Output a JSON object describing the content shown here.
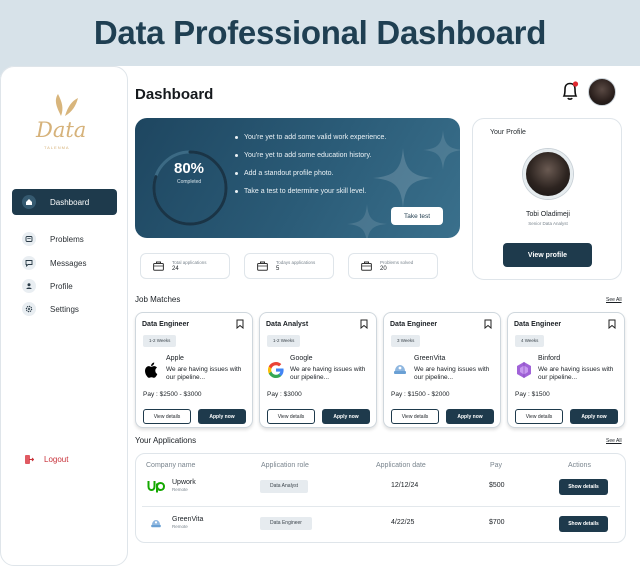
{
  "banner": {
    "title": "Data Professional Dashboard"
  },
  "brand": {
    "logo_text": "Data",
    "logo_sub": "TALENMA"
  },
  "sidebar": {
    "items": [
      {
        "label": "Dashboard",
        "icon": "home-icon",
        "active": true
      },
      {
        "label": "Problems",
        "icon": "problems-icon"
      },
      {
        "label": "Messages",
        "icon": "messages-icon"
      },
      {
        "label": "Profile",
        "icon": "user-icon"
      },
      {
        "label": "Settings",
        "icon": "gear-icon"
      }
    ],
    "logout": "Logout"
  },
  "header": {
    "title": "Dashboard"
  },
  "progress": {
    "percent_label": "80%",
    "caption": "Completed",
    "value": 0.8,
    "tasks": [
      "You're yet to add some valid work experience.",
      "You're yet to add some education history.",
      "Add a standout profile photo.",
      "Take a test to determine your skill level."
    ],
    "button": "Take test"
  },
  "profile": {
    "title": "Your Profile",
    "name": "Tobi Oladimeji",
    "role": "Senior Data Analyst",
    "button": "View profile"
  },
  "stats": [
    {
      "label": "Total applications",
      "value": "24"
    },
    {
      "label": "Todays applications",
      "value": "5"
    },
    {
      "label": "Problems solved",
      "value": "20"
    }
  ],
  "job_matches": {
    "title": "Job Matches",
    "see_all": "See All",
    "jobs": [
      {
        "title": "Data Engineer",
        "duration": "1-2 Weeks",
        "company": "Apple",
        "desc": "We are having issues with our pipeline...",
        "pay": "Pay : $2500 - $3000",
        "view": "View details",
        "apply": "Apply now"
      },
      {
        "title": "Data Analyst",
        "duration": "1-2 Weeks",
        "company": "Google",
        "desc": "We are having issues with our pipeline...",
        "pay": "Pay : $3000",
        "view": "View details",
        "apply": "Apply now"
      },
      {
        "title": "Data Engineer",
        "duration": "3 Weeks",
        "company": "GreenVita",
        "desc": "We are having issues with our pipeline...",
        "pay": "Pay : $1500 - $2000",
        "view": "View details",
        "apply": "Apply now"
      },
      {
        "title": "Data Engineer",
        "duration": "4 Weeks",
        "company": "Binford",
        "desc": "We are having issues with our pipeline...",
        "pay": "Pay : $1500",
        "view": "View details",
        "apply": "Apply now"
      }
    ]
  },
  "applications": {
    "title": "Your Applications",
    "see_all": "See All",
    "columns": [
      "Company name",
      "Application role",
      "Application date",
      "Pay",
      "Actions"
    ],
    "rows": [
      {
        "company": "Upwork",
        "location": "Remote",
        "role": "Data Analyst",
        "date": "12/12/24",
        "pay": "$500",
        "action": "Show details"
      },
      {
        "company": "GreenVita",
        "location": "Remote",
        "role": "Data Engineer",
        "date": "4/22/25",
        "pay": "$700",
        "action": "Show details"
      }
    ]
  }
}
